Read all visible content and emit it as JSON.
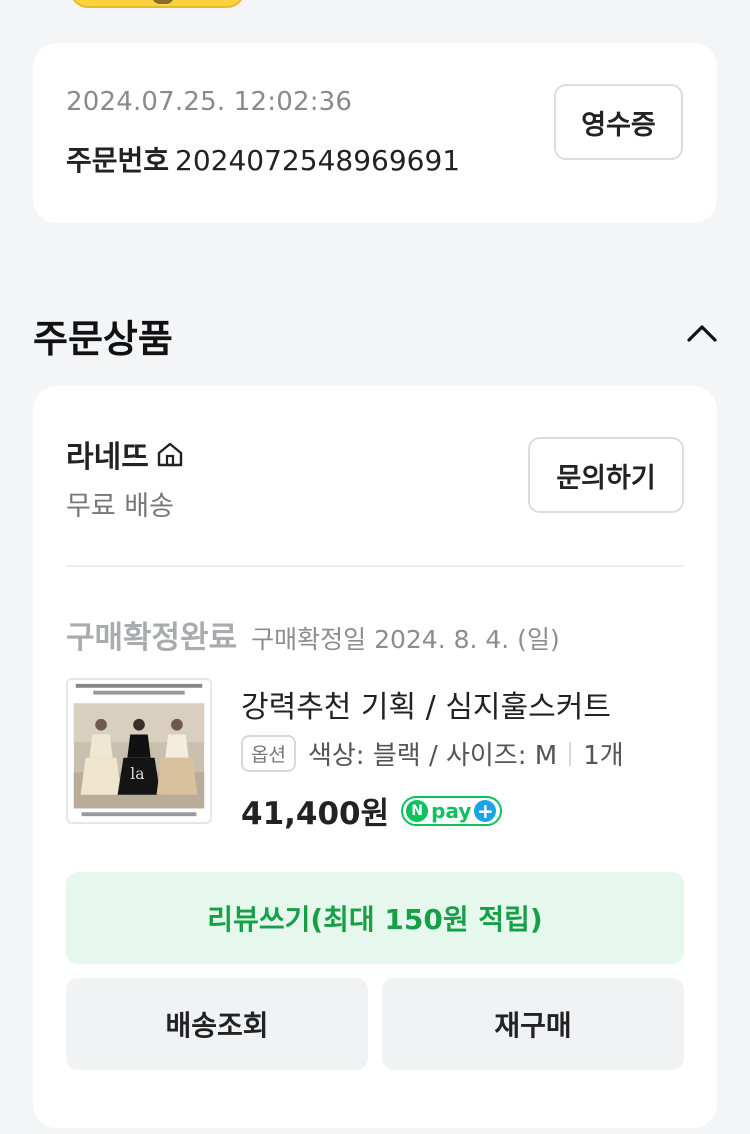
{
  "order": {
    "datetime": "2024.07.25. 12:02:36",
    "number_label": "주문번호",
    "number_value": "2024072548969691",
    "receipt_button": "영수증"
  },
  "section": {
    "title": "주문상품",
    "toggle_icon": "chevron-up-icon"
  },
  "store": {
    "name": "라네뜨",
    "home_icon": "home-icon",
    "shipping": "무료 배송",
    "inquiry_button": "문의하기"
  },
  "item": {
    "status": "구매확정완료",
    "confirm_date": "구매확정일 2024. 8. 4. (일)",
    "title": "강력추천 기획 / 심지훌스커트",
    "option_badge": "옵션",
    "option_text": "색상: 블랙 / 사이즈: M",
    "quantity": "1개",
    "price": "41,400원",
    "npay_n": "N",
    "npay_text": "pay",
    "npay_plus": "+"
  },
  "actions": {
    "review": "리뷰쓰기(최대 150원 적립)",
    "track": "배송조회",
    "rebuy": "재구매"
  },
  "colors": {
    "accent_green": "#15a046",
    "review_bg": "#e6f7ee",
    "npay_green": "#0cc25f"
  }
}
